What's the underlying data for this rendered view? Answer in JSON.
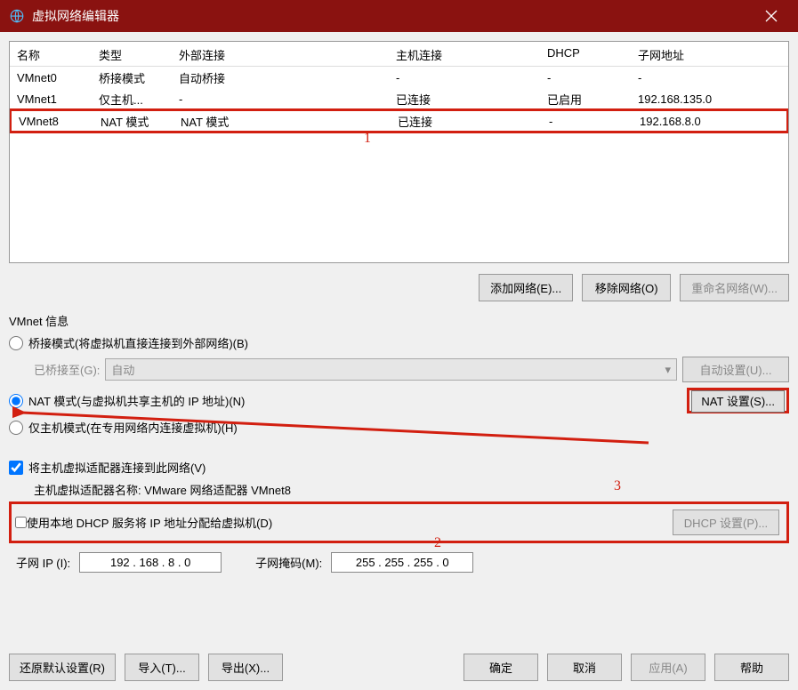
{
  "title": "虚拟网络编辑器",
  "table": {
    "headers": {
      "name": "名称",
      "type": "类型",
      "ext": "外部连接",
      "host": "主机连接",
      "dhcp": "DHCP",
      "subnet": "子网地址"
    },
    "rows": [
      {
        "name": "VMnet0",
        "type": "桥接模式",
        "ext": "自动桥接",
        "host": "-",
        "dhcp": "-",
        "subnet": "-"
      },
      {
        "name": "VMnet1",
        "type": "仅主机...",
        "ext": "-",
        "host": "已连接",
        "dhcp": "已启用",
        "subnet": "192.168.135.0"
      },
      {
        "name": "VMnet8",
        "type": "NAT 模式",
        "ext": "NAT 模式",
        "host": "已连接",
        "dhcp": "-",
        "subnet": "192.168.8.0"
      }
    ]
  },
  "annotations": {
    "one": "1",
    "two": "2",
    "three": "3"
  },
  "buttons": {
    "add_network": "添加网络(E)...",
    "remove_network": "移除网络(O)",
    "rename_network": "重命名网络(W)..."
  },
  "info": {
    "group_label": "VMnet 信息",
    "bridge_radio": "桥接模式(将虚拟机直接连接到外部网络)(B)",
    "bridge_to_label": "已桥接至(G):",
    "bridge_dropdown": "自动",
    "auto_setting_btn": "自动设置(U)...",
    "nat_radio": "NAT 模式(与虚拟机共享主机的 IP 地址)(N)",
    "nat_setting_btn": "NAT 设置(S)...",
    "hostonly_radio": "仅主机模式(在专用网络内连接虚拟机)(H)",
    "connect_adapter_check": "将主机虚拟适配器连接到此网络(V)",
    "adapter_name_label": "主机虚拟适配器名称: VMware 网络适配器 VMnet8",
    "dhcp_check": "使用本地 DHCP 服务将 IP 地址分配给虚拟机(D)",
    "dhcp_setting_btn": "DHCP 设置(P)...",
    "subnet_ip_label": "子网 IP (I):",
    "subnet_ip_value": "192 . 168 .  8  .  0",
    "subnet_mask_label": "子网掩码(M):",
    "subnet_mask_value": "255 . 255 . 255 .  0"
  },
  "bottom": {
    "restore": "还原默认设置(R)",
    "import": "导入(T)...",
    "export": "导出(X)...",
    "ok": "确定",
    "cancel": "取消",
    "apply": "应用(A)",
    "help": "帮助"
  }
}
